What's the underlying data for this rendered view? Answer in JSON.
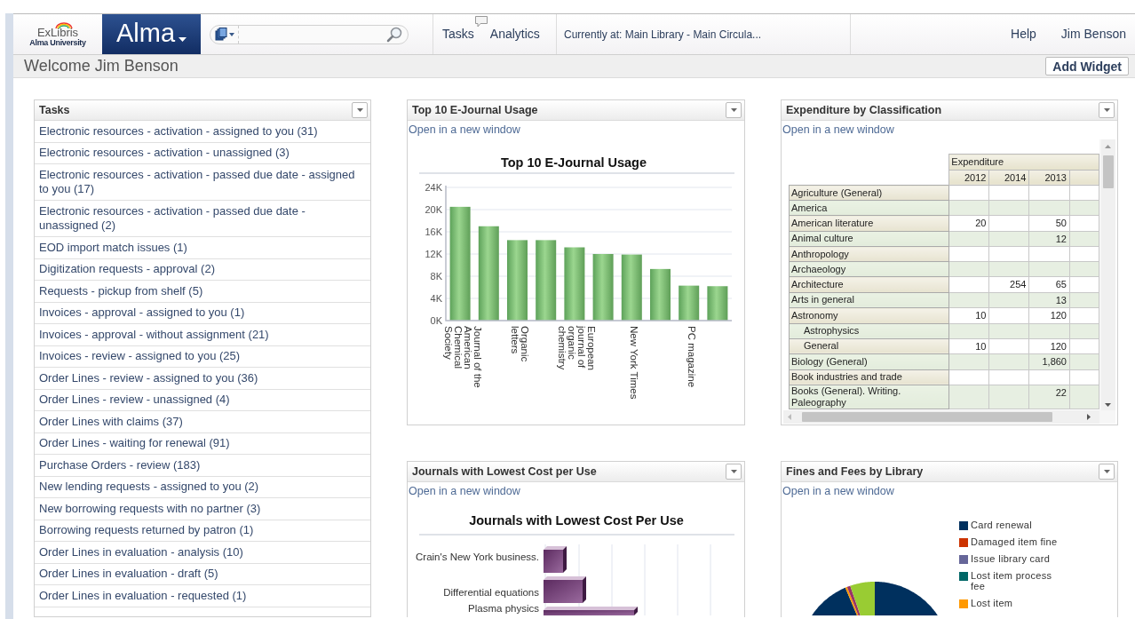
{
  "header": {
    "logo": {
      "brand": "ExLibris",
      "institution": "Alma University"
    },
    "product_menu": "Alma",
    "nav": [
      "Tasks",
      "Analytics"
    ],
    "location": "Currently at: Main Library - Main Circula...",
    "links": [
      "Help",
      "Jim Benson"
    ]
  },
  "welcome": "Welcome Jim Benson",
  "add_widget": "Add Widget",
  "widgets": [
    {
      "kind": "tasks",
      "title": "Tasks",
      "items": [
        "Electronic resources - activation - assigned to you (31)",
        "Electronic resources - activation - unassigned (3)",
        "Electronic resources - activation - passed due date - assigned to you (17)",
        "Electronic resources - activation - passed due date - unassigned (2)",
        "EOD import match issues (1)",
        "Digitization requests - approval (2)",
        "Requests - pickup from shelf (5)",
        "Invoices - approval - assigned to you (1)",
        "Invoices - approval - without assignment (21)",
        "Invoices - review - assigned to you (25)",
        "Order Lines - review - assigned to you (36)",
        "Order Lines - review - unassigned (4)",
        "Order Lines with claims (37)",
        "Order Lines - waiting for renewal (91)",
        "Purchase Orders - review (183)",
        "New lending requests - assigned to you (2)",
        "New borrowing requests with no partner (3)",
        "Borrowing requests returned by patron (1)",
        "Order Lines in evaluation - analysis (10)",
        "Order Lines in evaluation - draft (5)",
        "Order Lines in evaluation - requested (1)"
      ]
    },
    {
      "kind": "bar_chart",
      "title": "Top 10 E-Journal Usage",
      "link": "Open in a new window",
      "chart_data": {
        "type": "bar",
        "title": "Top 10 E-Journal Usage",
        "grid": true,
        "categories": [
          "Journal of the American Chemical Society",
          null,
          "Organic letters",
          null,
          "European journal of organic chemistry",
          null,
          "New York Times",
          null,
          "PC magazine",
          null
        ],
        "values": [
          20500,
          17000,
          14500,
          14500,
          13200,
          12000,
          11900,
          9300,
          6300,
          6200
        ],
        "ylim": [
          0,
          24000
        ],
        "yticks": [
          {
            "value": 0,
            "label": "0K"
          },
          {
            "value": 4000,
            "label": "4K"
          },
          {
            "value": 8000,
            "label": "8K"
          },
          {
            "value": 12000,
            "label": "12K"
          },
          {
            "value": 16000,
            "label": "16K"
          },
          {
            "value": 20000,
            "label": "20K"
          },
          {
            "value": 24000,
            "label": "24K"
          }
        ]
      }
    },
    {
      "kind": "pivot_table",
      "title": "Expenditure by Classification",
      "link": "Open in a new window",
      "group_header": "Expenditure",
      "columns": [
        "2012",
        "2014",
        "2013"
      ],
      "rows": [
        {
          "label": "Agriculture (General)"
        },
        {
          "label": "America"
        },
        {
          "label": "American literature",
          "col_1": "20",
          "col_3": "50"
        },
        {
          "label": "Animal culture",
          "col_3": "12"
        },
        {
          "label": "Anthropology"
        },
        {
          "label": "Archaeology"
        },
        {
          "label": "Architecture",
          "col_2": "254",
          "col_3": "65"
        },
        {
          "label": "Arts in general",
          "col_3": "13"
        },
        {
          "label": "Astronomy",
          "col_1": "10",
          "col_3": "120",
          "children": [
            {
              "label": "Astrophysics"
            },
            {
              "label": "General",
              "col_1": "10",
              "col_3": "120"
            }
          ]
        },
        {
          "label": "Biology (General)",
          "col_3": "1,860"
        },
        {
          "label": "Book industries and trade"
        },
        {
          "label": "Books (General). Writing. Paleography",
          "col_3": "22"
        }
      ]
    },
    {
      "kind": "hbar_picture",
      "title": "Journals with Lowest Cost per Use",
      "link": "Open in a new window",
      "chart_title": "Journals with Lowest Cost Per Use",
      "labels": [
        "Crain's New York business.",
        "Differential equations",
        "Plasma physics"
      ]
    },
    {
      "kind": "pie_picture",
      "title": "Fines and Fees by Library",
      "link": "Open in a new window",
      "legend": [
        {
          "label": "Card renewal",
          "color": "#00305e"
        },
        {
          "label": "Damaged item fine",
          "color": "#cc3300"
        },
        {
          "label": "Issue library card",
          "color": "#666699"
        },
        {
          "label": "Lost item process fee",
          "color": "#006666"
        },
        {
          "label": "Lost item",
          "color": "#ff9900"
        }
      ]
    }
  ]
}
